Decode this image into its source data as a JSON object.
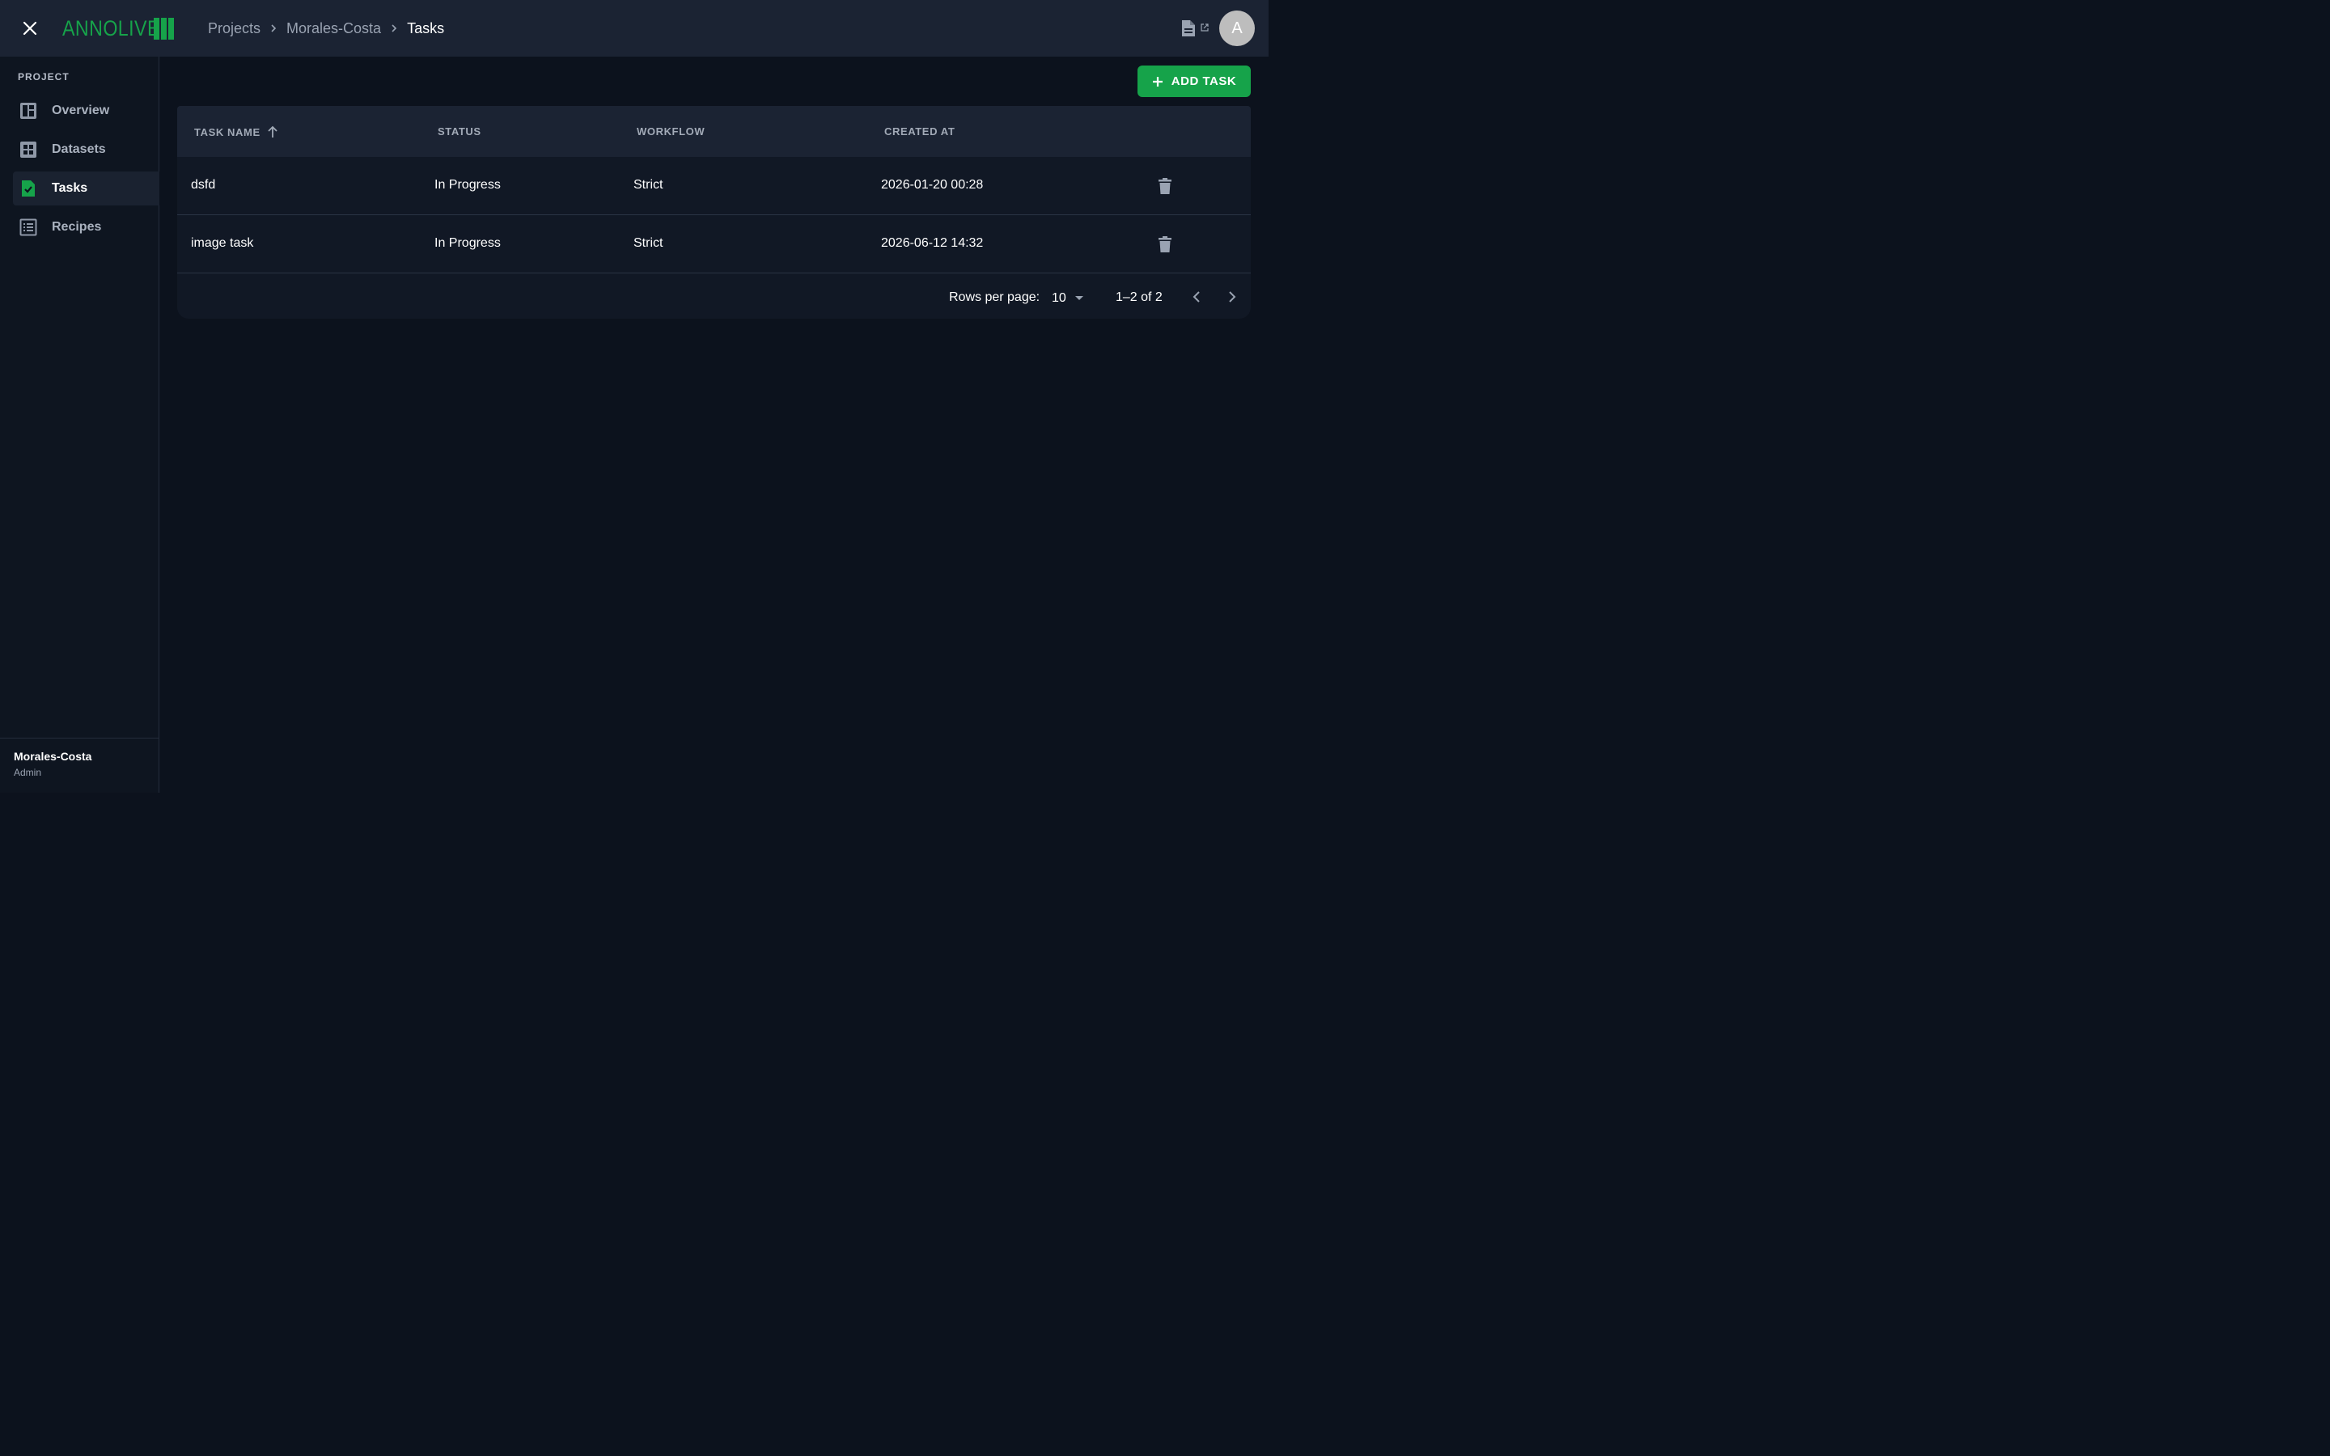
{
  "app": {
    "logo_text": "ANNOLIVE",
    "brand_color": "#16a34a",
    "user_initial": "A"
  },
  "breadcrumb": {
    "items": [
      "Projects",
      "Morales-Costa"
    ],
    "current": "Tasks"
  },
  "sidebar": {
    "section_label": "PROJECT",
    "items": [
      {
        "label": "Overview",
        "icon": "dashboard-icon",
        "active": false
      },
      {
        "label": "Datasets",
        "icon": "grid-icon",
        "active": false
      },
      {
        "label": "Tasks",
        "icon": "task-check-icon",
        "active": true
      },
      {
        "label": "Recipes",
        "icon": "list-icon",
        "active": false
      }
    ],
    "footer": {
      "project_name": "Morales-Costa",
      "role": "Admin"
    }
  },
  "toolbar": {
    "add_task_label": "ADD TASK"
  },
  "table": {
    "columns": [
      "TASK NAME",
      "STATUS",
      "WORKFLOW",
      "CREATED AT"
    ],
    "sort": {
      "column": "TASK NAME",
      "direction": "ascending"
    },
    "rows": [
      {
        "name": "dsfd",
        "status": "In Progress",
        "workflow": "Strict",
        "created_at": "2026-01-20 00:28"
      },
      {
        "name": "image task",
        "status": "In Progress",
        "workflow": "Strict",
        "created_at": "2026-06-12 14:32"
      }
    ]
  },
  "pagination": {
    "rows_per_page_label": "Rows per page:",
    "rows_per_page_value": "10",
    "range_label": "1–2 of 2"
  }
}
